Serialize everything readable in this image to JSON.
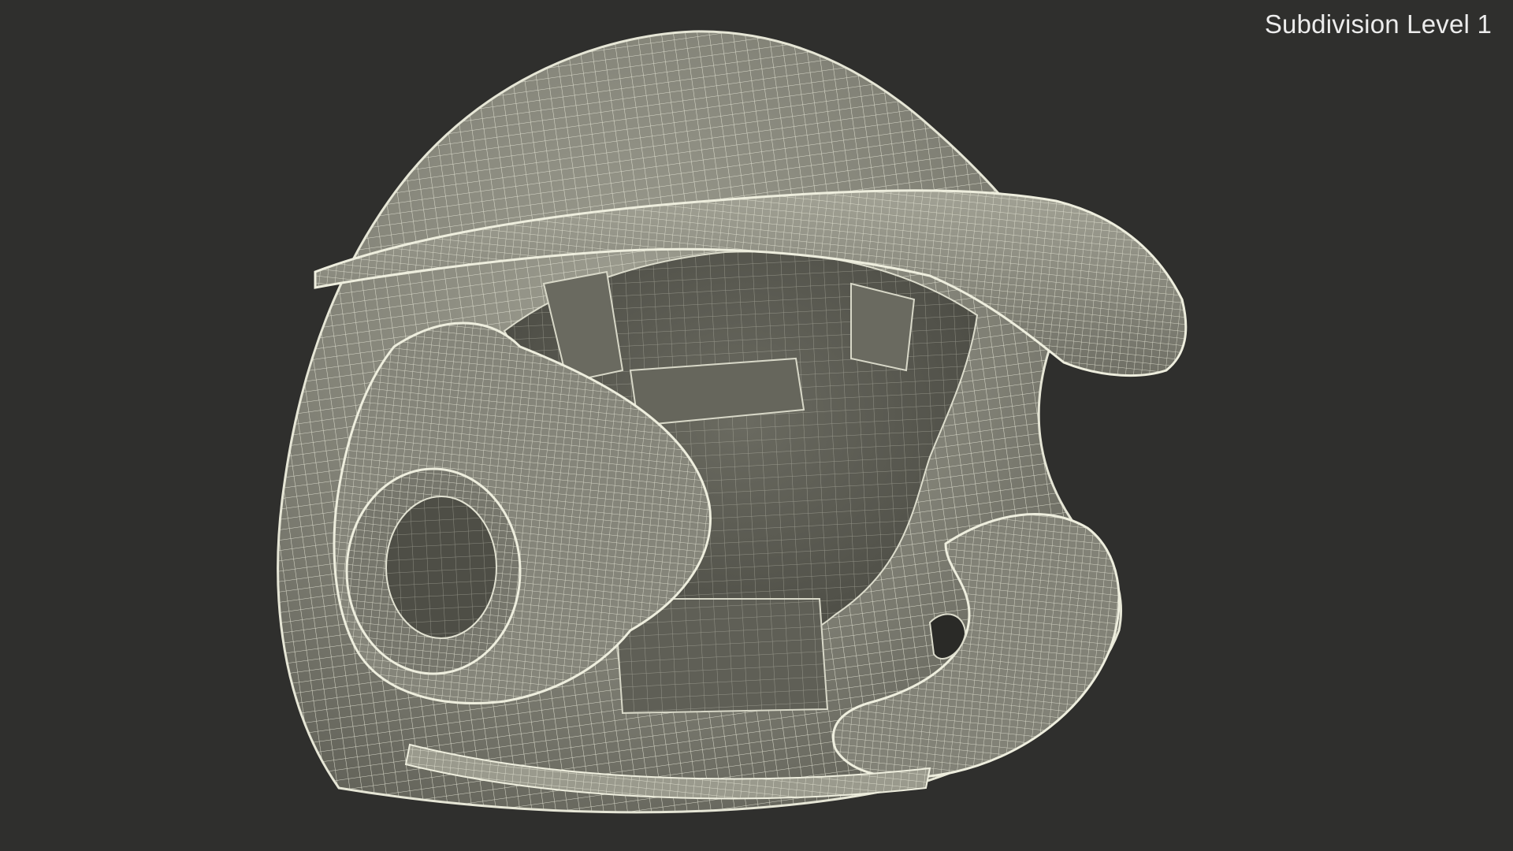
{
  "viewport": {
    "overlay_label": "Subdivision Level 1"
  },
  "model": {
    "subject": "baseball batting helmet wireframe",
    "shading": "wireframe-over-shaded",
    "colors": {
      "background": "#2f2f2d",
      "surface": "#7d7d72",
      "surface_light": "#9a9a8d",
      "surface_dark": "#5c5c53",
      "interior": "#55554c",
      "wire": "#e6e6d6"
    }
  }
}
